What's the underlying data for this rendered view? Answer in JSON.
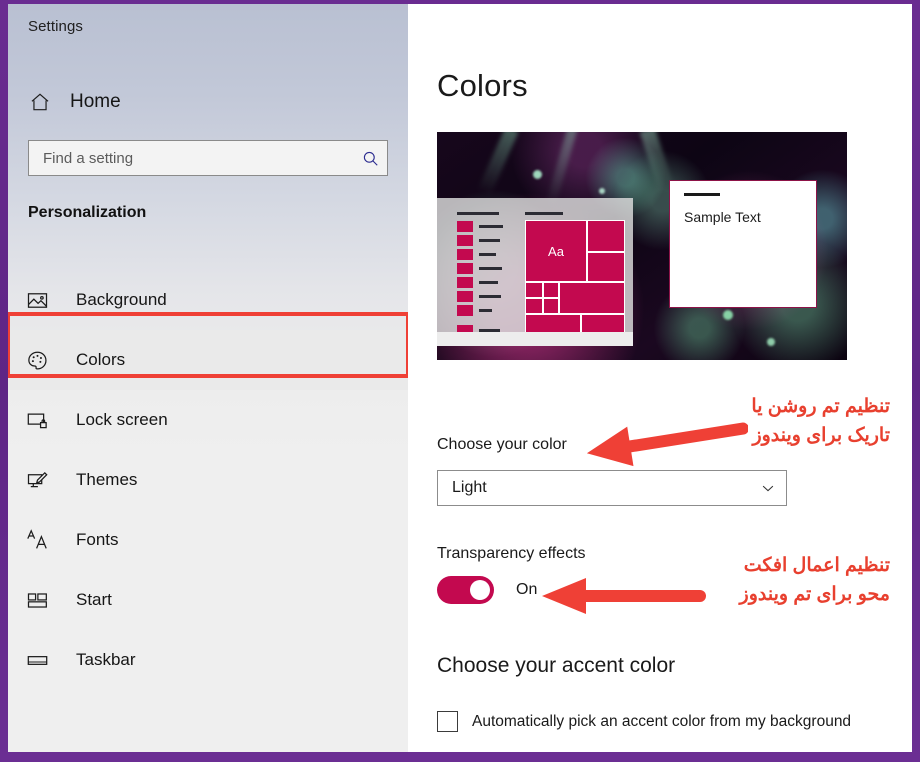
{
  "window": {
    "app_title": "Settings",
    "frame_color": "#6B2D8F"
  },
  "sidebar": {
    "home_label": "Home",
    "home_icon": "home-icon",
    "search": {
      "placeholder": "Find a setting",
      "value": "",
      "icon": "search-icon"
    },
    "section_header": "Personalization",
    "items": [
      {
        "label": "Background",
        "icon": "picture-icon",
        "selected": false
      },
      {
        "label": "Colors",
        "icon": "palette-icon",
        "selected": true
      },
      {
        "label": "Lock screen",
        "icon": "monitor-lock-icon",
        "selected": false
      },
      {
        "label": "Themes",
        "icon": "monitor-brush-icon",
        "selected": false
      },
      {
        "label": "Fonts",
        "icon": "font-size-icon",
        "selected": false
      },
      {
        "label": "Start",
        "icon": "start-tiles-icon",
        "selected": false
      },
      {
        "label": "Taskbar",
        "icon": "taskbar-icon",
        "selected": false
      }
    ],
    "highlight_color": "#EF4036"
  },
  "main": {
    "page_title": "Colors",
    "preview": {
      "sample_text": "Sample Text",
      "accent_color": "#C3094F"
    },
    "choose_color": {
      "label": "Choose your color",
      "selected": "Light",
      "chevron_icon": "chevron-down-icon"
    },
    "transparency": {
      "label": "Transparency effects",
      "state": "On",
      "toggle_color": "#C3094F"
    },
    "accent": {
      "heading": "Choose your accent color",
      "auto_pick_label": "Automatically pick an accent color from my background",
      "auto_pick_checked": false
    }
  },
  "annotations": {
    "color": "#E8402F",
    "items": [
      {
        "line1": "تنظیم تم روشن یا",
        "line2": "تاریک برای ویندوز",
        "arrow": "left-arrow-icon"
      },
      {
        "line1": "تنظیم اعمال افکت",
        "line2": "محو برای تم ویندوز",
        "arrow": "left-arrow-icon"
      }
    ]
  }
}
